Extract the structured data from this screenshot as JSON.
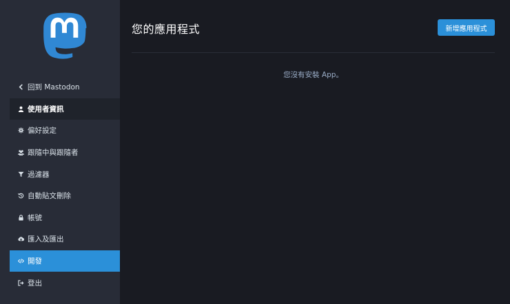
{
  "header": {
    "title": "您的應用程式",
    "new_app_label": "新增應用程式"
  },
  "sidebar": {
    "logo_icon": "mastodon-logo",
    "items": [
      {
        "label": "回到 Mastodon",
        "icon": "chevron-left-icon"
      },
      {
        "label": "使用者資訊",
        "icon": "user-icon"
      },
      {
        "label": "偏好設定",
        "icon": "gear-icon"
      },
      {
        "label": "跟隨中與跟隨者",
        "icon": "users-icon"
      },
      {
        "label": "過濾器",
        "icon": "filter-icon"
      },
      {
        "label": "自動貼文刪除",
        "icon": "history-icon"
      },
      {
        "label": "帳號",
        "icon": "lock-icon"
      },
      {
        "label": "匯入及匯出",
        "icon": "cloud-download-icon"
      },
      {
        "label": "開發",
        "icon": "code-icon"
      },
      {
        "label": "登出",
        "icon": "sign-out-icon"
      }
    ]
  },
  "main": {
    "empty_message": "您沒有安裝 App。"
  },
  "colors": {
    "accent": "#2b90d9",
    "sidebar_bg": "#282c37",
    "main_bg": "#191b22",
    "logo": "#3088d4"
  }
}
